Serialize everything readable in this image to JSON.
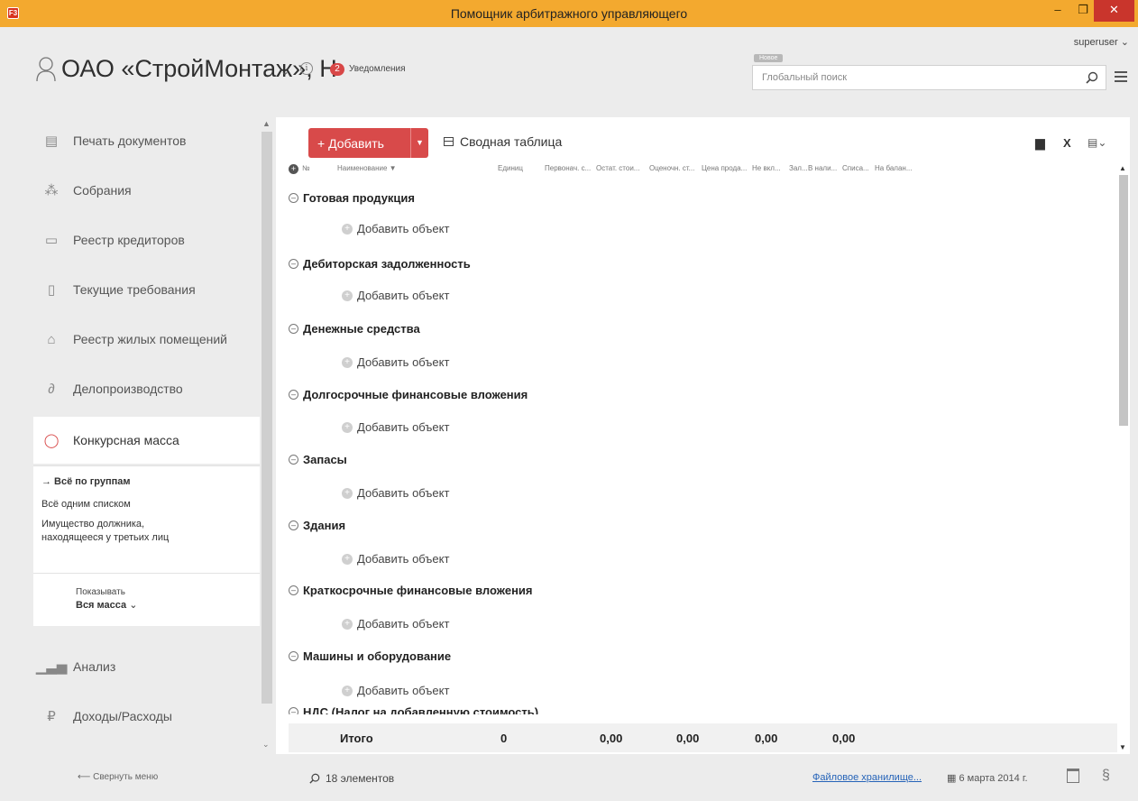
{
  "window": {
    "title": "Помощник арбитражного управляющего",
    "app_icon": "F3",
    "min": "–",
    "max": "❐",
    "close": "✕"
  },
  "header": {
    "user": "superuser",
    "company": "ОАО «СтройМонтаж», Н",
    "notifications_count": "2",
    "notifications_label": "Уведомления",
    "search_badge": "Новое",
    "search_placeholder": "Глобальный поиск"
  },
  "sidebar": {
    "items": [
      {
        "label": "Печать документов",
        "icon": "document-icon"
      },
      {
        "label": "Собрания",
        "icon": "meeting-icon"
      },
      {
        "label": "Реестр кредиторов",
        "icon": "registry-icon"
      },
      {
        "label": "Текущие требования",
        "icon": "requirement-icon"
      },
      {
        "label": "Реестр жилых помещений",
        "icon": "home-icon"
      },
      {
        "label": "Делопроизводство",
        "icon": "paperclip-icon"
      },
      {
        "label": "Конкурсная масса",
        "icon": "mass-icon",
        "active": true
      },
      {
        "label": "Анализ",
        "icon": "chart-icon"
      },
      {
        "label": "Доходы/Расходы",
        "icon": "ruble-icon"
      }
    ],
    "sub_items": [
      "→ Всё по группам",
      "Всё одним списком",
      "Имущество должника, находящееся у третьих лиц"
    ],
    "show_label": "Показывать",
    "show_value": "Вся масса",
    "collapse": "⟵ Свернуть меню"
  },
  "toolbar": {
    "add_label": "+ Добавить",
    "pivot_label": "Сводная таблица"
  },
  "columns": [
    "№",
    "Наименование ▼",
    "Единиц",
    "Первонач. с...",
    "Остат. стои...",
    "Оценочн. ст...",
    "Цена прода...",
    "Не вкл...",
    "Зал...",
    "В нали...",
    "Списа...",
    "На балан..."
  ],
  "groups": [
    "Готовая продукция",
    "Дебиторская задолженность",
    "Денежные средства",
    "Долгосрочные финансовые вложения",
    "Запасы",
    "Здания",
    "Краткосрочные финансовые вложения",
    "Машины и оборудование",
    "НДС (Налог на добавленную стоимость)"
  ],
  "add_object_label": "Добавить объект",
  "totals": {
    "label": "Итого",
    "values": [
      "0",
      "0,00",
      "0,00",
      "0,00",
      "0,00"
    ]
  },
  "footer": {
    "count": "18 элементов",
    "storage": "Файловое хранилище...",
    "date": "6 марта 2014 г."
  },
  "colors": {
    "titlebar": "#f3a92f",
    "accent": "#d84a4a",
    "close": "#c9352c",
    "link": "#2563b8"
  }
}
